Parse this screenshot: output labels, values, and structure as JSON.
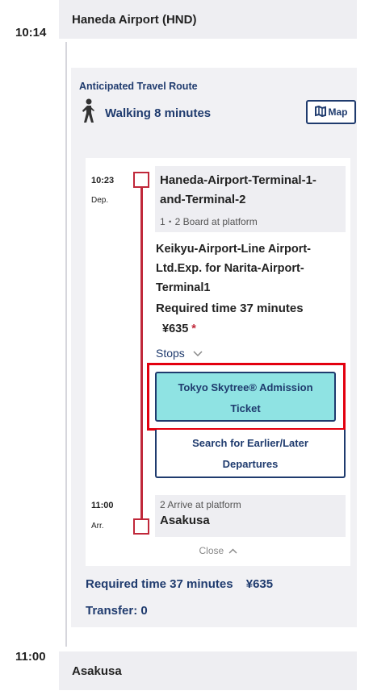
{
  "origin": {
    "time": "10:14",
    "name": "Haneda Airport (HND)"
  },
  "destination": {
    "time": "11:00",
    "name": "Asakusa"
  },
  "route": {
    "heading": "Anticipated Travel Route",
    "walk_icon": "walking-person-icon",
    "walk_text": "Walking 8 minutes",
    "map_icon": "map-icon",
    "map_label": "Map"
  },
  "segment": {
    "dep_time": "10:23",
    "dep_label": "Dep.",
    "dep_station_line1": "Haneda-Airport-Terminal-1-",
    "dep_station_line2": "and-Terminal-2",
    "dep_platform": "1・2 Board at platform",
    "train_line1": "Keikyu-Airport-Line Airport-",
    "train_line2": "Ltd.Exp. for Narita-Airport-",
    "train_line3": "Terminal1",
    "required": "Required time 37 minutes",
    "fare": "¥635",
    "fare_mark": "*",
    "stops_label": "Stops",
    "chevron_icon": "chevron-down-icon",
    "skytree_line1": "Tokyo Skytree® Admission",
    "skytree_line2": "Ticket",
    "search_line1": "Search for Earlier/Later",
    "search_line2": "Departures",
    "arr_time": "11:00",
    "arr_label": "Arr.",
    "arr_platform": "2 Arrive at platform",
    "arr_station": "Asakusa",
    "close_label": "Close",
    "close_icon": "chevron-up-icon"
  },
  "summary": {
    "required": "Required time 37 minutes",
    "fare": "¥635",
    "transfer": "Transfer: 0"
  },
  "colors": {
    "accent": "#1f3b6e",
    "rail": "#c0283a",
    "highlight": "#e3000f",
    "button_bg": "#8fe3e3"
  }
}
